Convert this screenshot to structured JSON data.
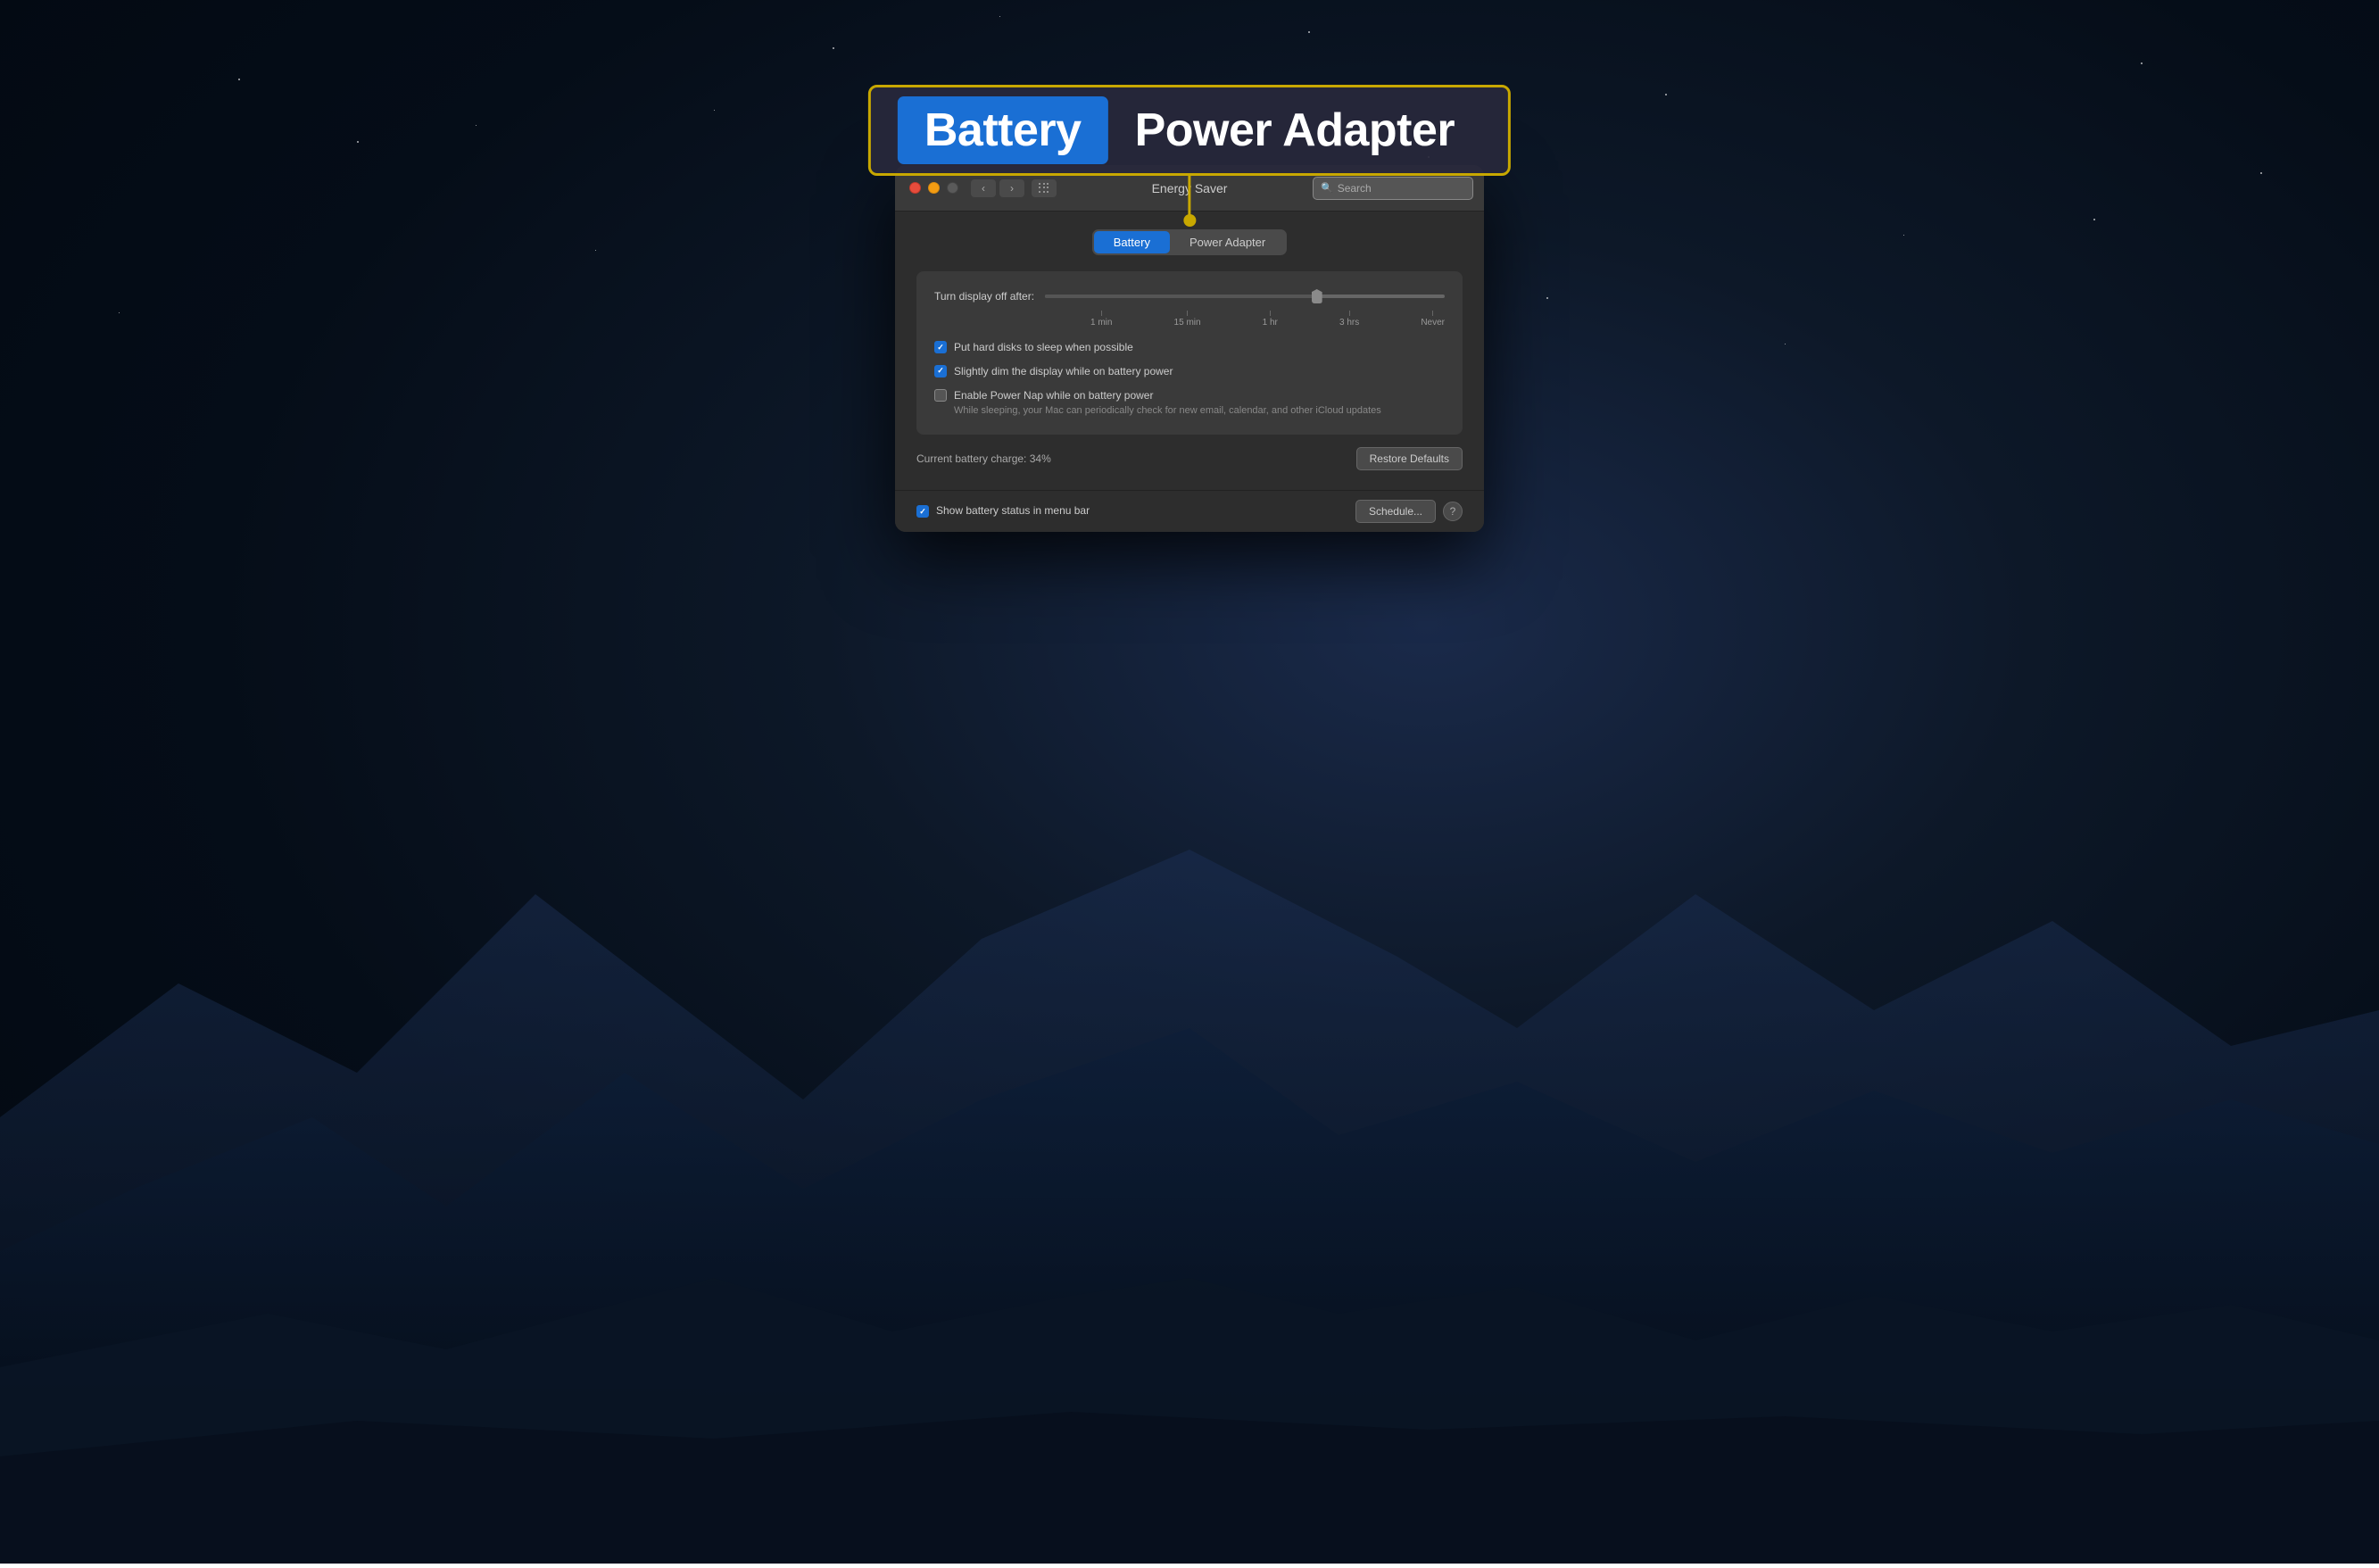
{
  "desktop": {
    "bg_description": "macOS Mojave dark desert night"
  },
  "annotation": {
    "battery_label": "Battery",
    "adapter_label": "Power Adapter",
    "border_color": "#c8a800"
  },
  "window": {
    "title": "Energy Saver",
    "search_placeholder": "Search",
    "traffic_lights": {
      "close": "close",
      "minimize": "minimize",
      "fullscreen": "fullscreen"
    }
  },
  "segment_control": {
    "battery_label": "Battery",
    "adapter_label": "Power Adapter",
    "active": "Battery"
  },
  "settings": {
    "slider_label": "Turn display off after:",
    "slider_ticks": [
      "1 min",
      "15 min",
      "1 hr",
      "3 hrs",
      "Never"
    ],
    "checkboxes": [
      {
        "id": "hard-disks",
        "label": "Put hard disks to sleep when possible",
        "checked": true,
        "sublabel": ""
      },
      {
        "id": "dim-display",
        "label": "Slightly dim the display while on battery power",
        "checked": true,
        "sublabel": ""
      },
      {
        "id": "power-nap",
        "label": "Enable Power Nap while on battery power",
        "checked": false,
        "sublabel": "While sleeping, your Mac can periodically check for new email, calendar, and other iCloud updates"
      }
    ],
    "battery_charge_label": "Current battery charge: 34%",
    "restore_defaults_label": "Restore Defaults"
  },
  "bottom_bar": {
    "show_battery_label": "Show battery status in menu bar",
    "show_battery_checked": true,
    "schedule_label": "Schedule...",
    "help_label": "?"
  }
}
